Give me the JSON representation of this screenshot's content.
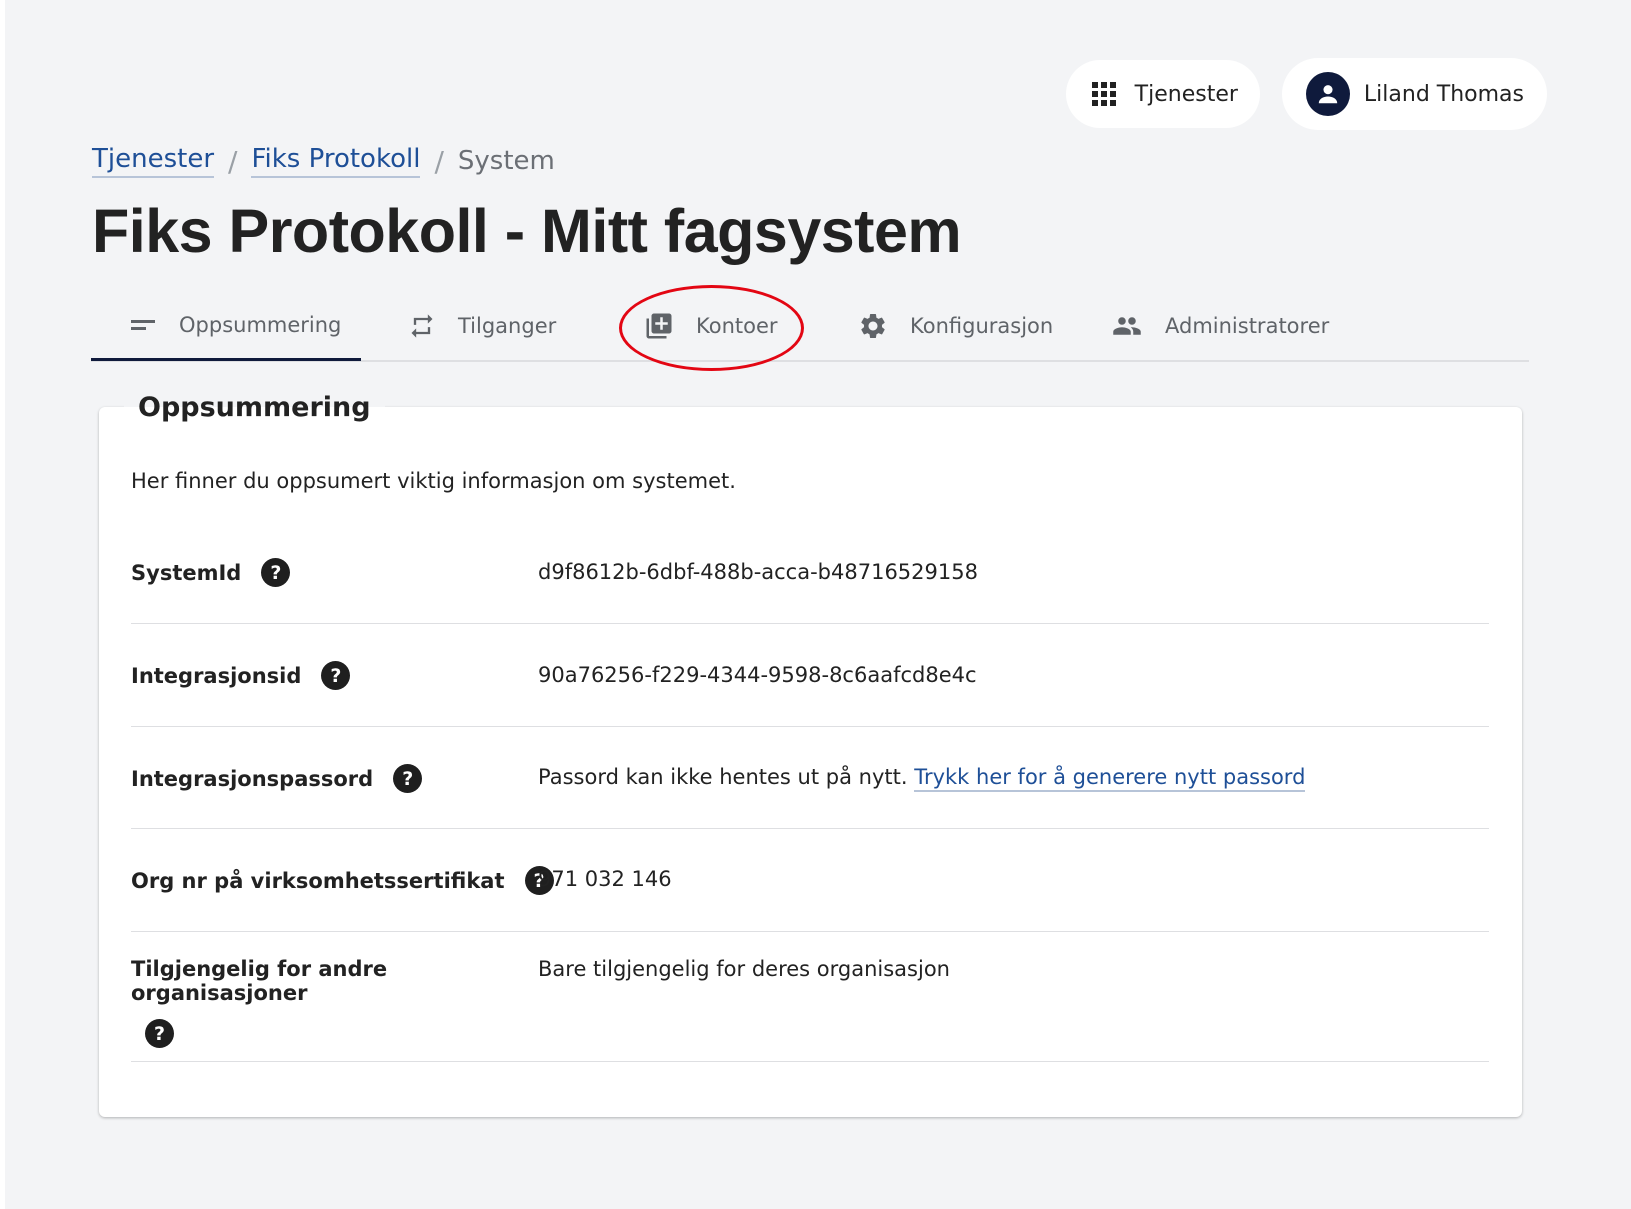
{
  "header": {
    "services_button": "Tjenester",
    "user_name": "Liland Thomas"
  },
  "breadcrumb": {
    "items": [
      "Tjenester",
      "Fiks Protokoll"
    ],
    "current": "System",
    "separator": "/"
  },
  "page_title": "Fiks Protokoll - Mitt fagsystem",
  "tabs": [
    {
      "label": "Oppsummering",
      "icon": "short-text-icon",
      "active": true
    },
    {
      "label": "Tilganger",
      "icon": "repeat-icon",
      "active": false
    },
    {
      "label": "Kontoer",
      "icon": "library-add-icon",
      "active": false,
      "highlighted": true
    },
    {
      "label": "Konfigurasjon",
      "icon": "gear-icon",
      "active": false
    },
    {
      "label": "Administratorer",
      "icon": "people-icon",
      "active": false
    }
  ],
  "summary": {
    "title": "Oppsummering",
    "intro": "Her finner du oppsumert viktig informasjon om systemet.",
    "help_glyph": "?",
    "rows": [
      {
        "label": "SystemId",
        "value": "d9f8612b-6dbf-488b-acca-b48716529158"
      },
      {
        "label": "Integrasjonsid",
        "value": "90a76256-f229-4344-9598-8c6aafcd8e4c"
      },
      {
        "label": "Integrasjonspassord",
        "value": "Passord kan ikke hentes ut på nytt.",
        "link": "Trykk her for å generere nytt passord"
      },
      {
        "label": "Org nr på virksomhetssertifikat",
        "value": "971 032 146"
      },
      {
        "label": "Tilgjengelig for andre organisasjoner",
        "value": "Bare tilgjengelig for deres organisasjon"
      }
    ]
  },
  "colors": {
    "background": "#f3f4f6",
    "link": "#1e4f97",
    "active_tab_indicator": "#0f1a3c",
    "highlight_ellipse": "#e30613"
  }
}
